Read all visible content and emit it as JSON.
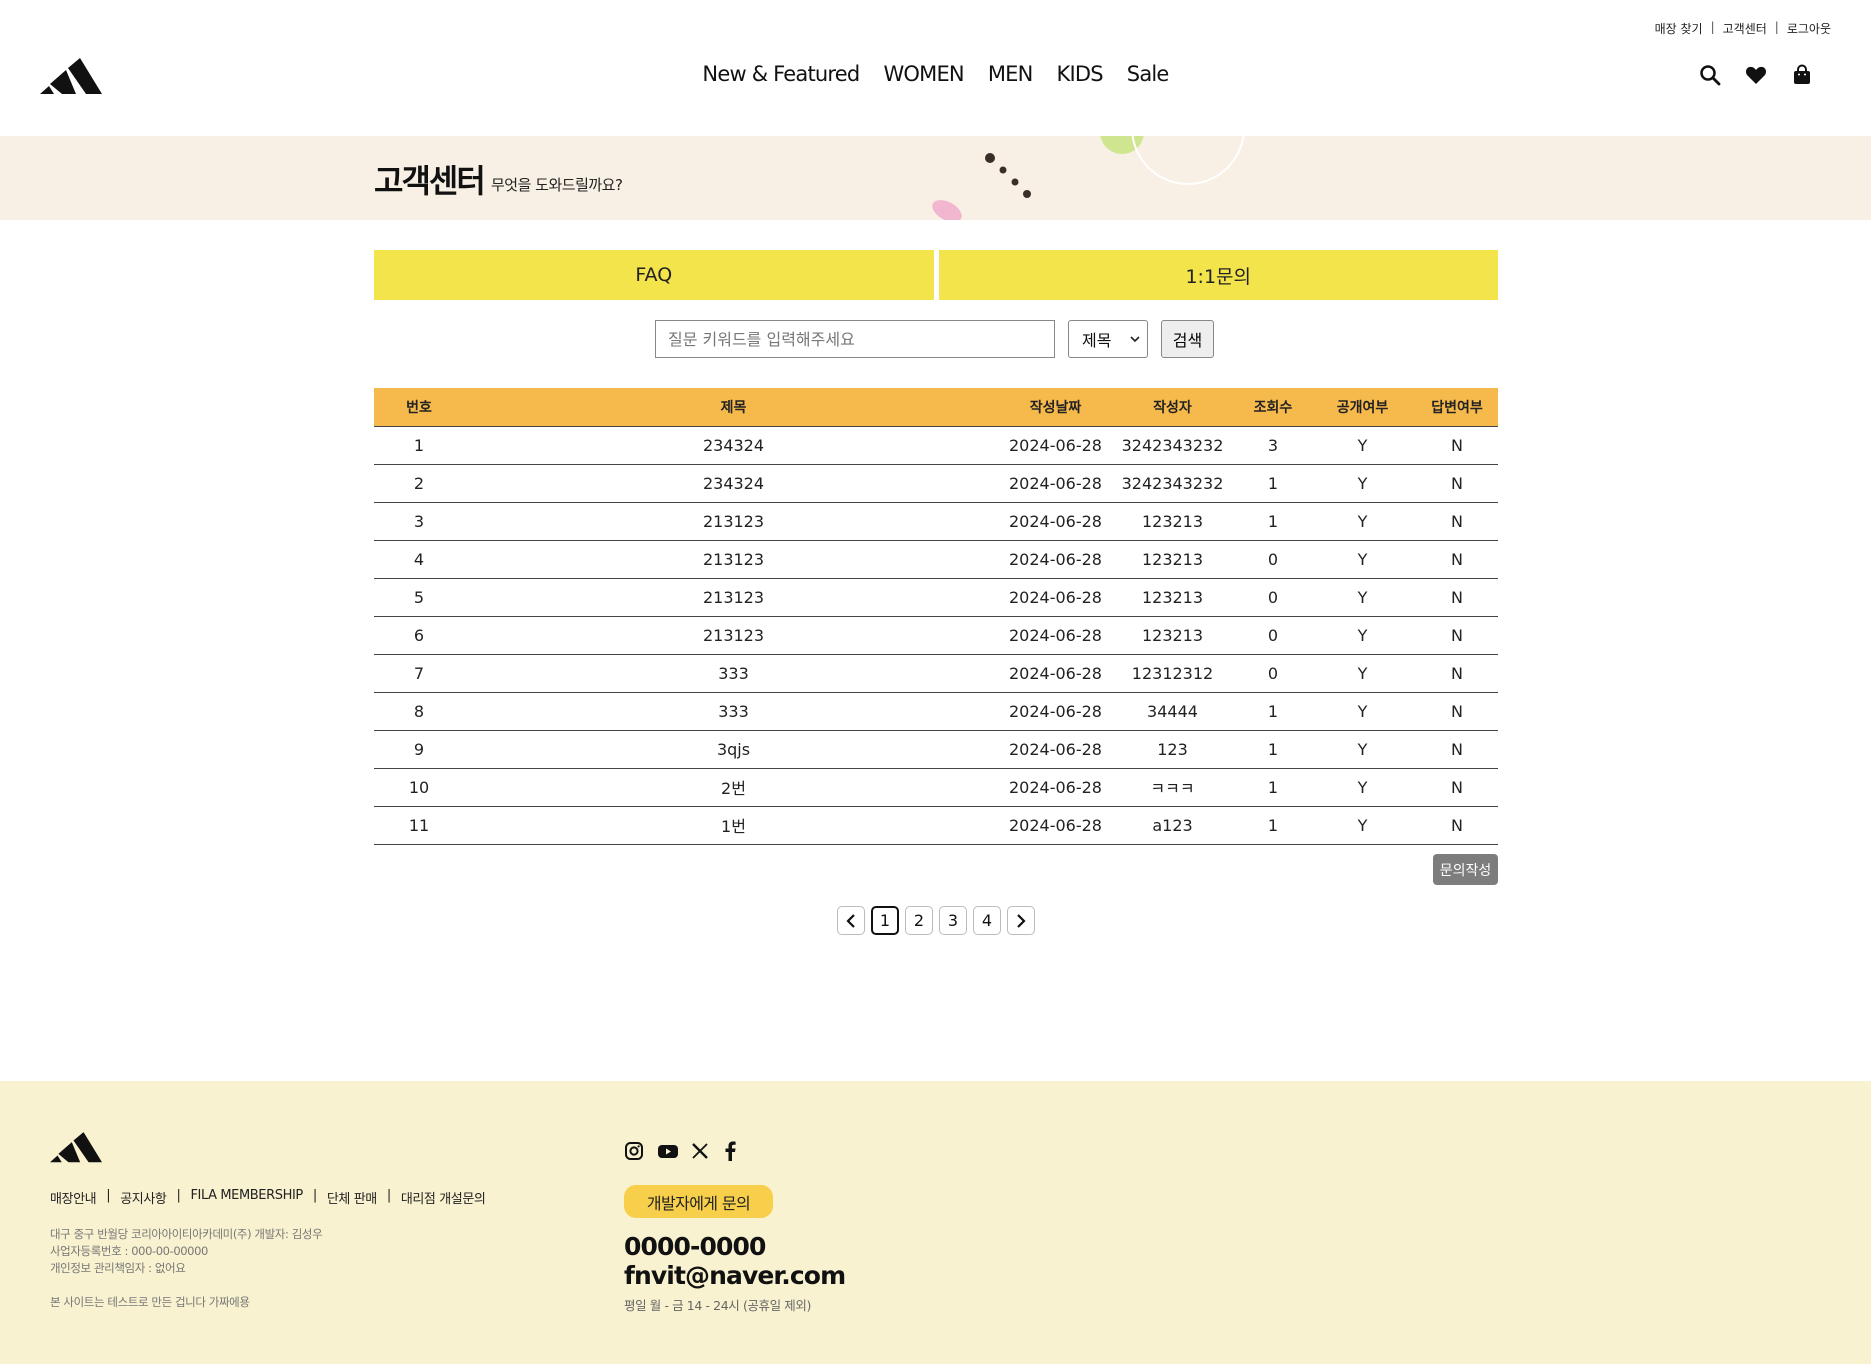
{
  "header": {
    "util_links": [
      "매장 찾기",
      "고객센터",
      "로그아웃"
    ],
    "nav": [
      "New & Featured",
      "WOMEN",
      "MEN",
      "KIDS",
      "Sale"
    ],
    "icons": [
      "search-icon",
      "heart-icon",
      "shopping-bag-icon"
    ]
  },
  "banner": {
    "title": "고객센터",
    "subtitle": "무엇을 도와드릴까요?"
  },
  "tabs": [
    "FAQ",
    "1:1문의"
  ],
  "search": {
    "placeholder": "질문 키워드를 입력해주세요",
    "select_value": "제목",
    "button": "검색"
  },
  "table": {
    "columns": [
      "번호",
      "제목",
      "작성날짜",
      "작성자",
      "조회수",
      "공개여부",
      "답변여부"
    ],
    "rows": [
      [
        "1",
        "234324",
        "2024-06-28",
        "3242343232",
        "3",
        "Y",
        "N"
      ],
      [
        "2",
        "234324",
        "2024-06-28",
        "3242343232",
        "1",
        "Y",
        "N"
      ],
      [
        "3",
        "213123",
        "2024-06-28",
        "123213",
        "1",
        "Y",
        "N"
      ],
      [
        "4",
        "213123",
        "2024-06-28",
        "123213",
        "0",
        "Y",
        "N"
      ],
      [
        "5",
        "213123",
        "2024-06-28",
        "123213",
        "0",
        "Y",
        "N"
      ],
      [
        "6",
        "213123",
        "2024-06-28",
        "123213",
        "0",
        "Y",
        "N"
      ],
      [
        "7",
        "333",
        "2024-06-28",
        "12312312",
        "0",
        "Y",
        "N"
      ],
      [
        "8",
        "333",
        "2024-06-28",
        "34444",
        "1",
        "Y",
        "N"
      ],
      [
        "9",
        "3qjs",
        "2024-06-28",
        "123",
        "1",
        "Y",
        "N"
      ],
      [
        "10",
        "2번",
        "2024-06-28",
        "ㅋㅋㅋ",
        "1",
        "Y",
        "N"
      ],
      [
        "11",
        "1번",
        "2024-06-28",
        "a123",
        "1",
        "Y",
        "N"
      ]
    ]
  },
  "write_button": "문의작성",
  "pagination": {
    "pages": [
      "1",
      "2",
      "3",
      "4"
    ],
    "current": "1"
  },
  "footer": {
    "menu": [
      "매장안내",
      "공지사항",
      "FILA MEMBERSHIP",
      "단체 판매",
      "대리점 개설문의"
    ],
    "info": [
      "대구 중구 반월당 코리아아이티아카데미(주) 개발자: 김성우",
      "사업자등록번호 : 000-00-00000",
      "개인정보 관리책임자 : 없어요"
    ],
    "note": "본 사이트는 테스트로 만든 겁니다 가짜에용",
    "social_icons": [
      "instagram-icon",
      "youtube-icon",
      "x-icon",
      "facebook-icon"
    ],
    "dev_button": "개발자에게 문의",
    "phone": "0000-0000",
    "email": "fnvit@naver.com",
    "hours": "평일 월 - 금 14 - 24시 (공휴일 제외)"
  },
  "colors": {
    "tab_bg": "#f3e44b",
    "table_header_bg": "#f6b94c",
    "banner_bg": "#f8f0e4",
    "footer_bg": "#f8f2d0",
    "dev_button_bg": "#f8cf4a"
  }
}
